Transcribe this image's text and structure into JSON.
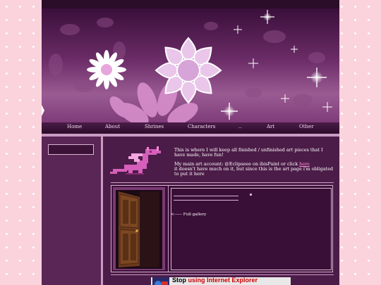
{
  "nav": {
    "items": [
      "Home",
      "About",
      "Shrines",
      "Characters",
      "..",
      "Art",
      "Other"
    ]
  },
  "intro": {
    "line1": "This is where I will keep all finished / unfinished art pieces that I",
    "line2": "have made, have fun!",
    "line3_prefix": "My main art account: @Eclipseee on ibisPaint or click ",
    "line3_link": "here",
    "line4": "it doesn't have much on it, but since this is the art page i'm obligated",
    "line5": "to put it here"
  },
  "gallery": {
    "full_gallery_label": "<------ Full gallery"
  },
  "footer": {
    "stop_text": "Stop",
    "ie_text": "using Internet Explorer"
  },
  "colors": {
    "background_pink": "#fbd3dd",
    "panel_purple": "#4c1c48",
    "accent_lilac": "#c99bc1",
    "link_pink": "#ff8fd8"
  }
}
